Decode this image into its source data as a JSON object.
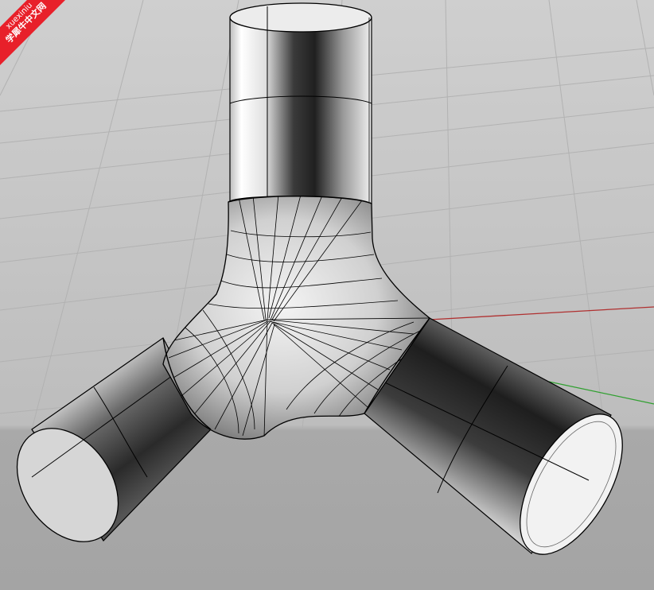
{
  "viewport": {
    "watermark": {
      "line1": "xuexiniu",
      "line2": "学犀牛中文网",
      "color": "#e8202a"
    },
    "colors": {
      "background_top": "#c9c9c9",
      "background_bottom": "#a6a6a6",
      "grid_line": "#b4b4b4",
      "x_axis": "#b03030",
      "y_axis": "#30a030",
      "isocurve": "#000000"
    }
  }
}
